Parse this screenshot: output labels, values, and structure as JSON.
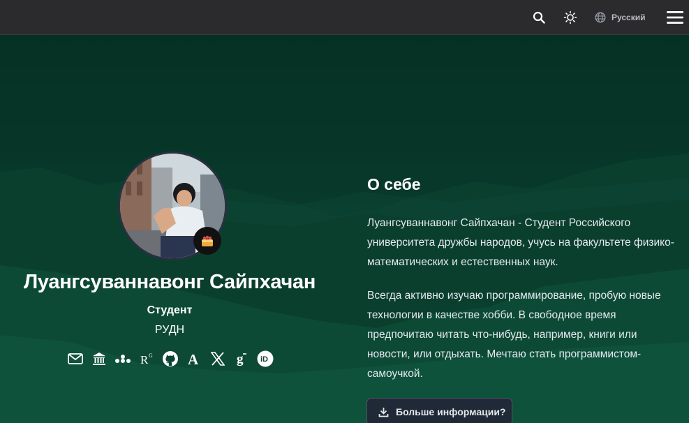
{
  "navbar": {
    "search_icon": "search-icon",
    "theme_icon": "sun-icon",
    "language_icon": "globe-icon",
    "language_label": "Русский",
    "menu_icon": "hamburger-menu-icon"
  },
  "profile": {
    "name": "Луангсуваннавонг Сайпхачан",
    "role": "Студент",
    "organization": "РУДН",
    "badge_icon": "cake-emoji",
    "socials": [
      {
        "icon": "envelope-icon"
      },
      {
        "icon": "institution-icon"
      },
      {
        "icon": "network-icon"
      },
      {
        "icon": "researchgate-icon",
        "text": "R"
      },
      {
        "icon": "github-icon"
      },
      {
        "icon": "academia-icon",
        "text": "A"
      },
      {
        "icon": "x-twitter-icon"
      },
      {
        "icon": "google-scholar-icon",
        "text": "g"
      },
      {
        "icon": "orcid-icon",
        "text": "iD"
      }
    ]
  },
  "about": {
    "title": "О себе",
    "paragraph1": "Луангсуваннавонг Сайпхачан - Студент Российского университета дружбы народов, учусь на факультете физико-математических и естественных наук.",
    "paragraph2": "Всегда активно изучаю программирование, пробую новые технологии в качестве хобби. В свободное время предпочитаю читать что-нибудь, например, книги или новости, или отдыхать. Мечтаю стать программистом-самоучкой.",
    "more_button_label": "Больше информации?",
    "more_button_icon": "download-icon"
  },
  "colors": {
    "navbar_bg": "#2b2b2d",
    "hero_dark": "#052c20",
    "hero_light": "#0e4d37",
    "button_bg": "#1f2937"
  }
}
